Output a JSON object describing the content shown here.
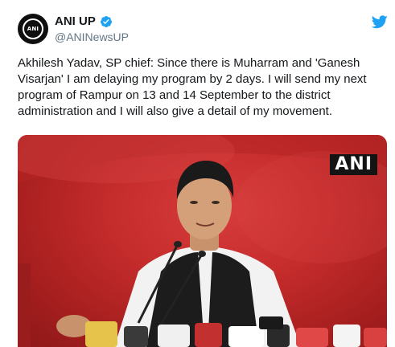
{
  "account": {
    "display_name": "ANI UP",
    "handle": "@ANINewsUP",
    "avatar_text": "ANI",
    "verified": true
  },
  "tweet": {
    "text": "Akhilesh Yadav, SP chief: Since there is Muharram and 'Ganesh Visarjan' I am delaying my program by 2 days. I will send my next program of Rampur on 13 and 14 September to the district administration and I will also give a detail of my movement."
  },
  "media": {
    "watermark": "ANI"
  },
  "icons": {
    "verified": "verified-badge-icon",
    "platform": "twitter-bird-icon"
  },
  "colors": {
    "brand_blue": "#1da1f2",
    "handle_gray": "#657786",
    "backdrop_red": "#c42b2b"
  }
}
